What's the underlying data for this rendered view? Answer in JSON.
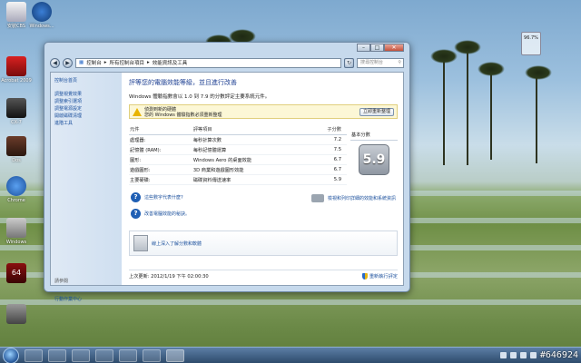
{
  "desktop": {
    "icons": [
      {
        "label": "安裝CBS"
      },
      {
        "label": "Windows..."
      },
      {
        "label": "Acrobat 2009"
      },
      {
        "label": "CX-7"
      },
      {
        "label": "Dos"
      },
      {
        "label": "Chrome"
      },
      {
        "label": "Windows"
      },
      {
        "label": "64"
      },
      {
        "label": ""
      }
    ],
    "gadget_value": "96.7%"
  },
  "window": {
    "caption_buttons": {
      "minimize": "–",
      "maximize": "□",
      "close": "✕"
    },
    "address": {
      "segments": [
        "控制台",
        "所有控制台項目",
        "效能資訊及工具"
      ]
    },
    "search_placeholder": "搜尋控制台",
    "sidebar": {
      "home": "控制台首頁",
      "items": [
        "調整視覺效果",
        "調整索引選項",
        "調整電源設定",
        "開啟磁碟清理",
        "進階工具"
      ],
      "see_also": "請參閱",
      "action_center": "行動作業中心"
    },
    "main": {
      "title": "評等您的電腦效能等級，並且進行改善",
      "subtitle": "Windows 體驗指數會以 1.0 到 7.9 的分數評定主要系統元件。",
      "warning": {
        "line1": "偵測到新的硬體",
        "line2": "您的 Windows 體驗指數必須重新整理",
        "button": "立即重新整理"
      },
      "table": {
        "headers": [
          "元件",
          "評等項目",
          "子分數",
          "基本分數"
        ],
        "rows": [
          {
            "component": "處理器:",
            "item": "每秒計算次數",
            "score": "7.2"
          },
          {
            "component": "記憶體 (RAM):",
            "item": "每秒記憶體運算",
            "score": "7.5"
          },
          {
            "component": "圖形:",
            "item": "Windows Aero 的桌面效能",
            "score": "6.7"
          },
          {
            "component": "遊戲圖形:",
            "item": "3D 商業和遊戲圖形效能",
            "score": "6.7"
          },
          {
            "component": "主要硬碟:",
            "item": "磁碟資料傳送速率",
            "score": "5.9"
          }
        ],
        "base_score": "5.9"
      },
      "links": {
        "q1": "這些數字代表什麼?",
        "q2": "改善電腦效能的秘訣。",
        "print": "檢視和列印詳細的效能和系統資訊",
        "store": "線上深入了解分數和軟體"
      },
      "footer": {
        "updated_label": "上次更新:",
        "updated_value": "2012/1/19 下午 02:00:30",
        "rerun": "重新執行評定"
      }
    }
  },
  "taskbar": {
    "watermark": "#646924"
  }
}
